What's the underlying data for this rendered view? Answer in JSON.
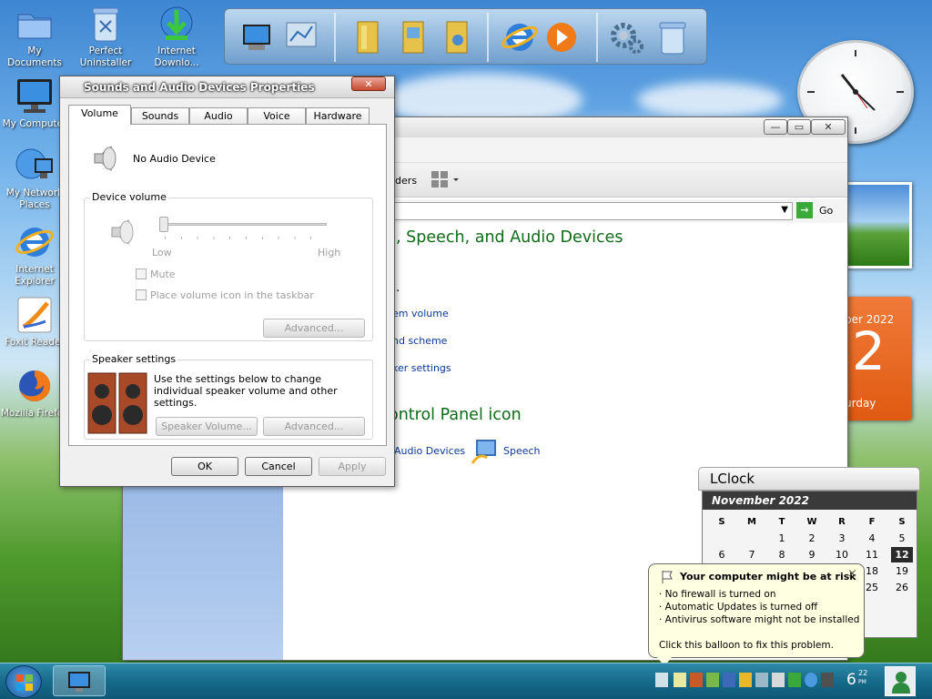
{
  "desktop": {
    "icons": [
      {
        "label": "My Documents"
      },
      {
        "label": "Perfect Uninstaller"
      },
      {
        "label": "Internet Downlo..."
      },
      {
        "label": "My Computer"
      },
      {
        "label": "My Network Places"
      },
      {
        "label": "Internet Explorer"
      },
      {
        "label": "Foxit Reader"
      },
      {
        "label": "Mozilla Firefox"
      }
    ]
  },
  "dock": {
    "items": [
      "my-computer-icon",
      "network-icon",
      "folder-icon",
      "pictures-folder-icon",
      "music-folder-icon",
      "internet-explorer-icon",
      "media-player-icon",
      "settings-gears-icon",
      "recycle-bin-icon"
    ]
  },
  "control_panel": {
    "toolbar_folders": "lders",
    "go_label": "Go",
    "heading_category": ", Speech, and Audio Devices",
    "tasks_label": "..",
    "task_links": [
      "em volume",
      "nd scheme",
      "ker settings"
    ],
    "heading_icon": "ontrol Panel icon",
    "icon_items": [
      "Audio Devices",
      "Speech"
    ]
  },
  "dialog": {
    "title": "Sounds and Audio Devices Properties",
    "tabs": [
      "Volume",
      "Sounds",
      "Audio",
      "Voice",
      "Hardware"
    ],
    "active_tab": "Volume",
    "device_name": "No Audio Device",
    "device_volume_label": "Device volume",
    "slider_low": "Low",
    "slider_high": "High",
    "volume_level": 0,
    "mute_label": "Mute",
    "taskbar_icon_label": "Place volume icon in the taskbar",
    "advanced_label": "Advanced...",
    "speaker_settings_label": "Speaker settings",
    "speaker_text": "Use the settings below to change individual speaker volume and other settings.",
    "speaker_volume_label": "Speaker Volume...",
    "speaker_advanced_label": "Advanced...",
    "ok_label": "OK",
    "cancel_label": "Cancel",
    "apply_label": "Apply"
  },
  "gadgets": {
    "calendar_month": "ber 2022",
    "calendar_day": "2",
    "calendar_weekday": "urday"
  },
  "lclock": {
    "title": "LClock",
    "month": "November 2022",
    "day_names": [
      "S",
      "M",
      "T",
      "W",
      "R",
      "F",
      "S"
    ],
    "rows": [
      [
        "",
        "",
        "1",
        "2",
        "3",
        "4",
        "5"
      ],
      [
        "6",
        "7",
        "8",
        "9",
        "10",
        "11",
        "12"
      ],
      [
        "",
        "",
        "",
        "",
        "",
        "18",
        "19"
      ],
      [
        "",
        "",
        "",
        "",
        "",
        "25",
        "26"
      ]
    ],
    "today": "12"
  },
  "balloon": {
    "title": "Your computer might be at risk",
    "lines": [
      "· No firewall is turned on",
      "· Automatic Updates is turned off",
      "· Antivirus software might not be installed"
    ],
    "footer": "Click this balloon to fix this problem.",
    "close": "×"
  },
  "taskbar": {
    "clock_hour": "6",
    "clock_minutes": "22",
    "clock_ampm": "PM",
    "tray_icons": [
      "security-flag-icon",
      "network-icon",
      "shield-icon",
      "update-icon",
      "monitor-icon",
      "antivirus-icon",
      "speaker-icon",
      "display-icon",
      "check-icon",
      "globe-icon",
      "tools-icon"
    ]
  },
  "colors": {
    "link_blue": "#0a3a9a",
    "heading_green": "#0f6b18",
    "taskbar": "#166a8a",
    "calendar_orange": "#e05a12"
  }
}
